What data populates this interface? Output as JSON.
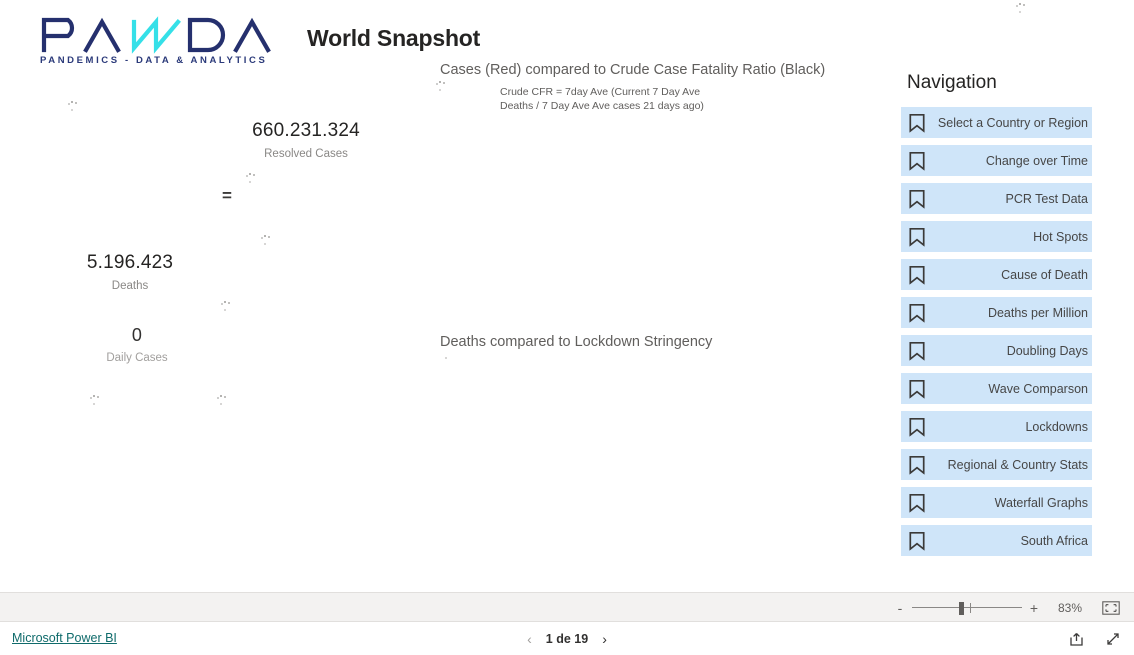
{
  "report": {
    "title": "World Snapshot",
    "logo": {
      "wordmark": "PANDA",
      "tagline": "PANDEMICS - DATA & ANALYTICS",
      "brand_color": "#25306e",
      "accent_color": "#35e0e8"
    },
    "visuals": {
      "cases_cfr_title": "Cases (Red) compared to Crude Case Fatality Ratio (Black)",
      "cases_cfr_subtitle_line1": "Crude CFR = 7day Ave (Current 7 Day Ave",
      "cases_cfr_subtitle_line2": "Deaths / 7 Day Ave Ave cases 21 days ago)",
      "deaths_lockdown_title": "Deaths compared to Lockdown Stringency",
      "equals_glyph": "="
    },
    "kpis": [
      {
        "value": "660.231.324",
        "label": "Resolved Cases"
      },
      {
        "value": "5.196.423",
        "label": "Deaths"
      },
      {
        "value": "0",
        "label": "Daily Cases"
      }
    ]
  },
  "navigation": {
    "heading": "Navigation",
    "item_background": "#cfe5f9",
    "items": [
      {
        "label": "Select a Country or Region",
        "icon": "bookmark-icon"
      },
      {
        "label": "Change over Time",
        "icon": "bookmark-icon"
      },
      {
        "label": "PCR Test Data",
        "icon": "bookmark-icon"
      },
      {
        "label": "Hot Spots",
        "icon": "bookmark-icon"
      },
      {
        "label": "Cause of Death",
        "icon": "bookmark-icon"
      },
      {
        "label": "Deaths per Million",
        "icon": "bookmark-icon"
      },
      {
        "label": "Doubling Days",
        "icon": "bookmark-icon"
      },
      {
        "label": "Wave Comparson",
        "icon": "bookmark-icon"
      },
      {
        "label": "Lockdowns",
        "icon": "bookmark-icon"
      },
      {
        "label": "Regional & Country Stats",
        "icon": "bookmark-icon"
      },
      {
        "label": "Waterfall Graphs",
        "icon": "bookmark-icon"
      },
      {
        "label": "South Africa",
        "icon": "bookmark-icon"
      }
    ]
  },
  "footer": {
    "brand_link": "Microsoft Power BI",
    "brand_link_color": "#0f6b6b",
    "pager": {
      "previous_icon": "chevron-left-icon",
      "label": "1 de 19",
      "next_icon": "chevron-right-icon"
    },
    "zoom": {
      "minus_label": "-",
      "plus_label": "+",
      "percent": "83%",
      "fit_icon": "fit-to-page-icon"
    },
    "actions": [
      {
        "icon": "share-icon"
      },
      {
        "icon": "fullscreen-icon"
      }
    ]
  }
}
